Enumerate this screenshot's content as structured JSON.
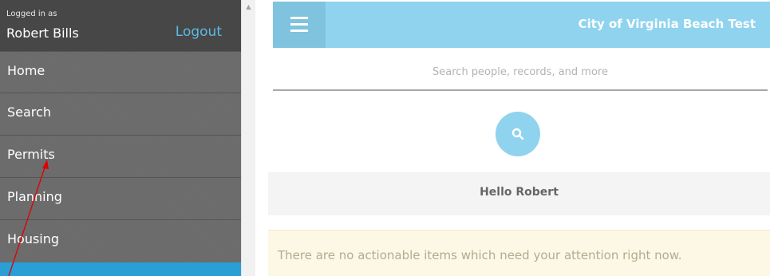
{
  "sidebar": {
    "logged_in_label": "Logged in as",
    "user_name": "Robert Bills",
    "logout_label": "Logout",
    "items": [
      {
        "label": "Home"
      },
      {
        "label": "Search"
      },
      {
        "label": "Permits"
      },
      {
        "label": "Planning"
      },
      {
        "label": "Housing"
      }
    ]
  },
  "header": {
    "title": "City of Virginia Beach Test",
    "menu_icon": "hamburger-icon"
  },
  "search": {
    "placeholder": "Search people, records, and more",
    "value": "",
    "button_icon": "search-icon"
  },
  "main": {
    "greeting": "Hello Robert",
    "notice": "There are no actionable items which need your attention right now."
  },
  "colors": {
    "accent": "#8fd3ef",
    "sidebar_bg": "#6b6b6b",
    "sidebar_header_bg": "#474747",
    "logout": "#5bbbe6",
    "active_strip": "#2a9fd6",
    "notice_bg": "#fdf8e6",
    "annotation_arrow": "#e00000"
  }
}
